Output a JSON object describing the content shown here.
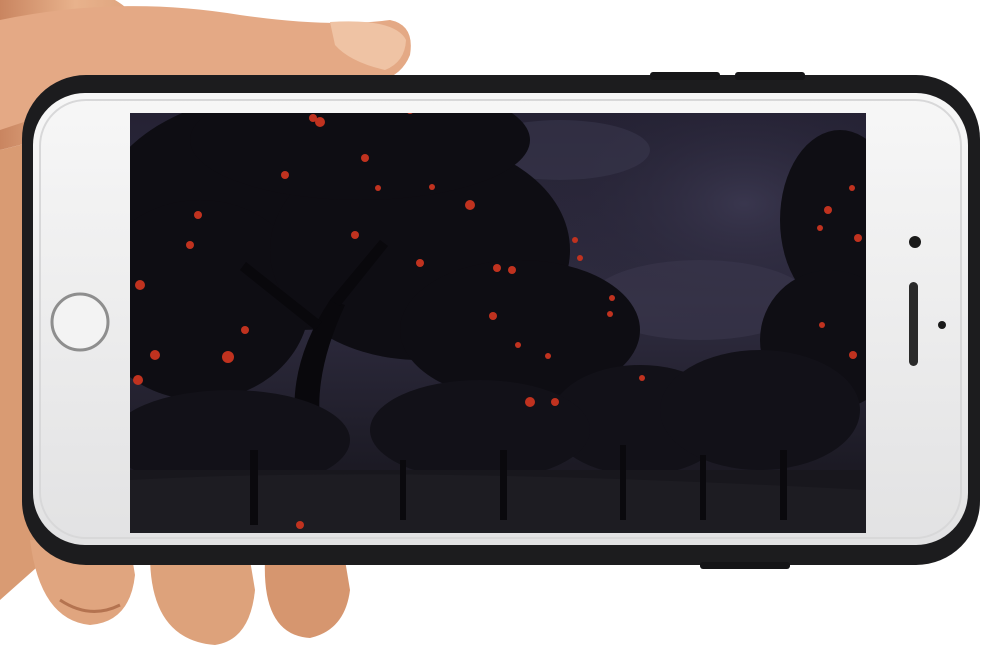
{
  "scene": {
    "description_free": true,
    "colors": {
      "background": "#ffffff",
      "skin_light": "#e9b58e",
      "skin_mid": "#d8976b",
      "skin_dark": "#b8744f",
      "case_black": "#1c1c1e",
      "phone_bezel": "#ededee",
      "screen_sky": "#2a2838",
      "screen_dark": "#16151d",
      "tree_dark": "#0d0c12",
      "apple_red": "#c0321f"
    }
  },
  "phone": {
    "orientation": "landscape",
    "icons": [
      "home-button-icon",
      "front-camera-icon",
      "earpiece-speaker-icon",
      "proximity-sensor-icon"
    ]
  },
  "screen": {
    "content": "night-orchard-photo"
  }
}
